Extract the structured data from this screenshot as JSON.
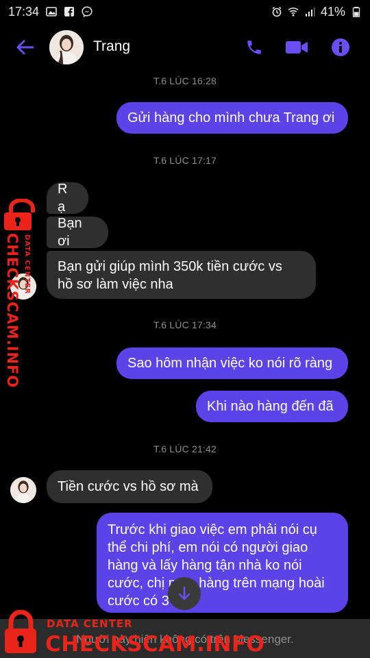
{
  "status_bar": {
    "time": "17:34",
    "battery": "41%",
    "icons": [
      "image-icon",
      "facebook-icon",
      "messenger-icon",
      "alarm-icon",
      "wifi-icon",
      "signal-icon",
      "battery-icon"
    ]
  },
  "header": {
    "contact_name": "Trang",
    "icons": [
      "back-arrow-icon",
      "phone-icon",
      "video-icon",
      "info-icon"
    ],
    "accent_color": "#5b43e8"
  },
  "messages": [
    {
      "type": "timestamp",
      "text": "T.6 LÚC 16:28"
    },
    {
      "type": "sent",
      "lines": [
        "Gửi hàng cho mình chưa Trang ơi"
      ]
    },
    {
      "type": "timestamp",
      "text": "T.6 LÚC 17:17"
    },
    {
      "type": "received",
      "lines": [
        "R ạ"
      ]
    },
    {
      "type": "received",
      "lines": [
        "Bạn ơi"
      ]
    },
    {
      "type": "received",
      "lines": [
        "Bạn gửi giúp mình 350k tiền cước vs",
        "hồ sơ làm việc nha"
      ]
    },
    {
      "type": "timestamp",
      "text": "T.6 LÚC 17:34"
    },
    {
      "type": "sent",
      "lines": [
        "Sao hôm nhận việc ko nói rõ ràng"
      ]
    },
    {
      "type": "sent",
      "lines": [
        "Khi nào hàng đến đã"
      ]
    },
    {
      "type": "timestamp",
      "text": "T.6 LÚC 21:42"
    },
    {
      "type": "received",
      "lines": [
        "Tiền cước vs hồ sơ mà"
      ]
    },
    {
      "type": "sent",
      "lines": [
        "Trước khi giao việc em phải nói cụ",
        "thể chi phí, em nói có người giao",
        "hàng và lấy hàng tận nhà ko nói",
        "cước, chị mua hàng trên mạng hoài",
        "cước có 3"
      ]
    }
  ],
  "bottom_bar": {
    "text": "Người này hiện không có trên Messenger."
  },
  "watermark": {
    "small": "DATA CENTER",
    "big": "CHECKSCAM.INFO",
    "color": "#e8241b"
  }
}
